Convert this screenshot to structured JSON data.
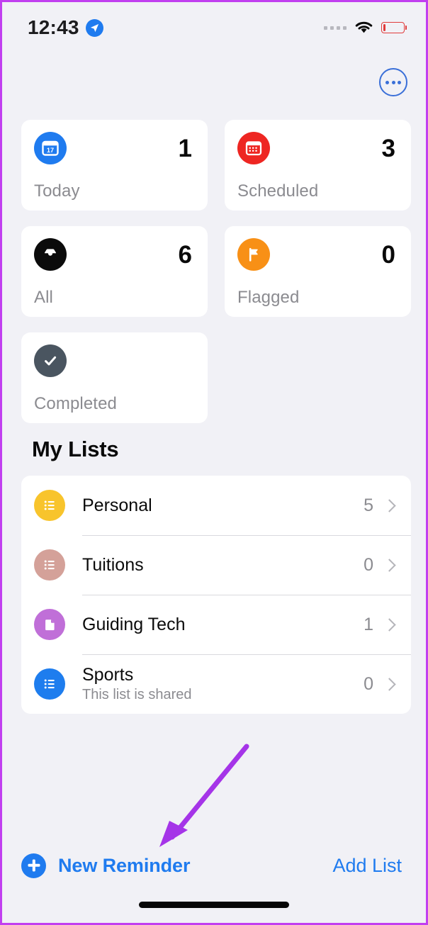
{
  "status_bar": {
    "time": "12:43",
    "location_icon": "location-arrow-icon",
    "signal_icon": "signal-dots-icon",
    "wifi_icon": "wifi-icon",
    "battery_icon": "battery-low-icon"
  },
  "header": {
    "more_button_icon": "more-ellipsis-icon"
  },
  "smart_cards": [
    {
      "label": "Today",
      "count": "1",
      "icon": "calendar-day-icon",
      "color": "#1f7bef"
    },
    {
      "label": "Scheduled",
      "count": "3",
      "icon": "calendar-grid-icon",
      "color": "#ee2622"
    },
    {
      "label": "All",
      "count": "6",
      "icon": "inbox-tray-icon",
      "color": "#0b0b0b"
    },
    {
      "label": "Flagged",
      "count": "0",
      "icon": "flag-icon",
      "color": "#f89016"
    },
    {
      "label": "Completed",
      "count": "",
      "icon": "checkmark-circle-icon",
      "color": "#4a5560"
    }
  ],
  "my_lists": {
    "title": "My Lists",
    "items": [
      {
        "name": "Personal",
        "subtitle": "",
        "count": "5",
        "icon": "list-bullet-icon",
        "color": "#f8c42c"
      },
      {
        "name": "Tuitions",
        "subtitle": "",
        "count": "0",
        "icon": "list-bullet-icon",
        "color": "#d4a199"
      },
      {
        "name": "Guiding Tech",
        "subtitle": "",
        "count": "1",
        "icon": "document-page-icon",
        "color": "#c06fd8"
      },
      {
        "name": "Sports",
        "subtitle": "This list is shared",
        "count": "0",
        "icon": "list-bullet-icon",
        "color": "#1e7dee"
      }
    ]
  },
  "bottom_bar": {
    "new_reminder_label": "New Reminder",
    "add_list_label": "Add List",
    "plus_icon": "plus-circle-icon"
  },
  "annotation": {
    "arrow_color": "#a534e8"
  },
  "theme": {
    "background": "#f1f1f6",
    "card_background": "#ffffff",
    "accent_blue": "#1f7bef",
    "secondary_text": "#8b8b90",
    "device_border": "#c13ff0"
  }
}
